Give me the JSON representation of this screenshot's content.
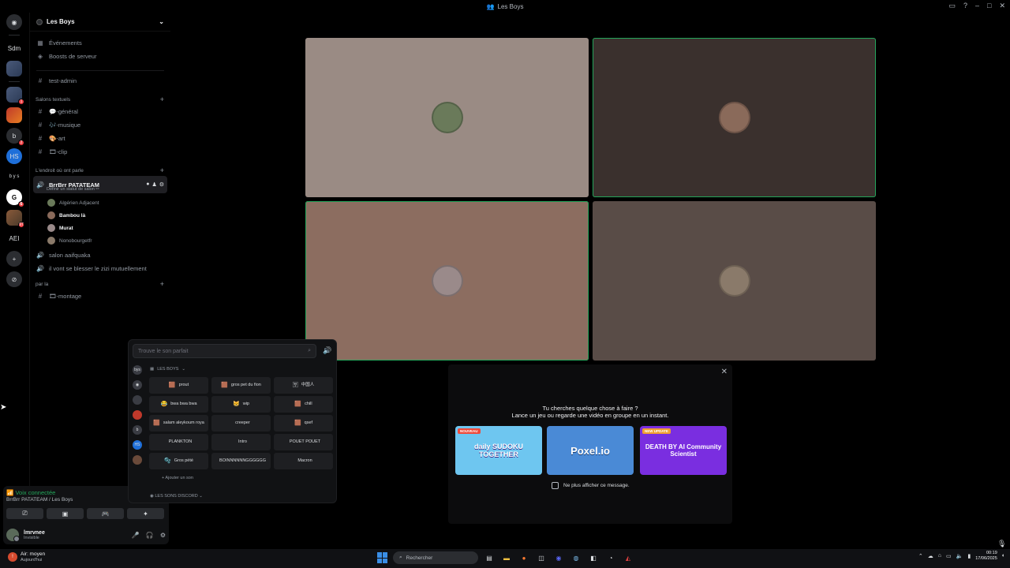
{
  "window": {
    "title": "Les Boys"
  },
  "rail": {
    "items": [
      {
        "label": "Sdm",
        "badge": ""
      },
      {
        "label": "",
        "badge": ""
      },
      {
        "label": "",
        "badge": "1"
      },
      {
        "label": "",
        "badge": ""
      },
      {
        "label": "",
        "badge": "2"
      },
      {
        "label": "HS",
        "badge": ""
      },
      {
        "label": "b y s",
        "badge": ""
      },
      {
        "label": "G",
        "badge": "6"
      },
      {
        "label": "",
        "badge": "97"
      },
      {
        "label": "AEI",
        "badge": ""
      }
    ]
  },
  "guild": {
    "name": "Les Boys",
    "top_items": [
      "Événements",
      "Boosts de serveur"
    ],
    "pinned_channel": "test-admin",
    "categories": [
      {
        "name": "Salons textuels",
        "channels": [
          "💬-général",
          "🎶-musique",
          "🎨-art",
          "🎞-clip"
        ]
      },
      {
        "name": "L'endroit où ont parle"
      },
      {
        "name": "par la"
      }
    ],
    "active_voice": {
      "name": "BrrBrr PATATEAM",
      "status": "Définir un statut de salon ✏",
      "users": [
        {
          "name": "Algérien Adjacent",
          "bold": false
        },
        {
          "name": "Bambou là",
          "bold": true
        },
        {
          "name": "Murat",
          "bold": true
        },
        {
          "name": "Nonobourgetfr",
          "bold": false
        }
      ]
    },
    "other_voice": [
      "salon aaifquaka",
      "il vont se blesser le zizi mutuellement"
    ],
    "par_la_channel": "🎞-montage"
  },
  "voice_panel": {
    "status": "Voix connectée",
    "location": "BrrBrr PATATEAM / Les Boys"
  },
  "user_panel": {
    "username": "lmrvnee",
    "status": "Invisible"
  },
  "video_tiles": [
    {
      "bg": "#9a8b84",
      "avatar": "#6a7a5a",
      "speaking": false
    },
    {
      "bg": "#3a302d",
      "avatar": "#8a6a5a",
      "speaking": true
    },
    {
      "bg": "#8c6d60",
      "avatar": "#9a8a8a",
      "speaking": true
    },
    {
      "bg": "#594c47",
      "avatar": "#8a7a6a",
      "speaking": false
    }
  ],
  "soundboard": {
    "search_placeholder": "Trouve le son parfait",
    "section_title": "LES BOYS",
    "sounds": [
      {
        "emoji": "🟫",
        "label": "prout"
      },
      {
        "emoji": "🟫",
        "label": "gros pet du fion"
      },
      {
        "emoji": "🈂",
        "label": "中国人"
      },
      {
        "emoji": "😂",
        "label": "bwa bwa bwa"
      },
      {
        "emoji": "😸",
        "label": "wip"
      },
      {
        "emoji": "🟫",
        "label": "chill"
      },
      {
        "emoji": "🟫",
        "label": "salam aleykoum roya"
      },
      {
        "emoji": "",
        "label": "creeper"
      },
      {
        "emoji": "🟫",
        "label": "qsef"
      },
      {
        "emoji": "",
        "label": "PLANKTON"
      },
      {
        "emoji": "",
        "label": "Intro"
      },
      {
        "emoji": "",
        "label": "POUET POUET"
      },
      {
        "emoji": "🫧",
        "label": "Gros pété"
      },
      {
        "emoji": "",
        "label": "BOINNNNNNGGGGGG"
      },
      {
        "emoji": "",
        "label": "Macron"
      }
    ],
    "add_sound": "+ Ajouter un son",
    "discord_section": "LES SONS DISCORD"
  },
  "activity": {
    "line1": "Tu cherches quelque chose à faire ?",
    "line2": "Lance un jeu ou regarde une vidéo en groupe en un instant.",
    "cards": [
      {
        "title": "daily SUDOKU TOGETHER",
        "tag": "NOUVEAU",
        "bg": "#6ec6f0",
        "tag_bg": "#f04a3a"
      },
      {
        "title": "Poxel.io",
        "tag": "",
        "bg": "#4a8ad6",
        "tag_bg": ""
      },
      {
        "title": "DEATH BY AI Community Scientist",
        "tag": "NEW UPDATE",
        "bg": "#7a2ee0",
        "tag_bg": "#f0a030"
      }
    ],
    "dont_show": "Ne plus afficher ce message."
  },
  "taskbar": {
    "weather_title": "Air: moyen",
    "weather_sub": "Aujourd'hui",
    "search_label": "Rechercher",
    "time": "00:19",
    "date": "17/06/2025"
  }
}
